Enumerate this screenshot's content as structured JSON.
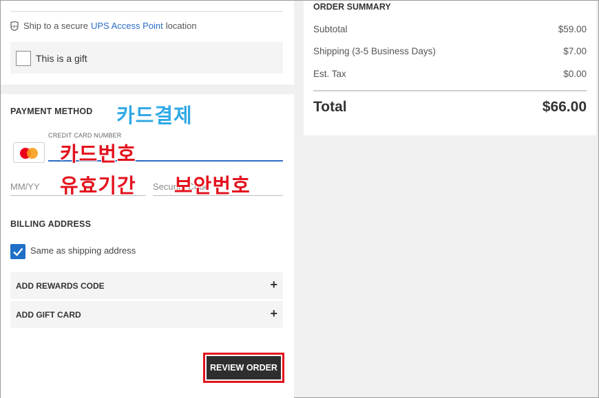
{
  "shipping": {
    "ship_prefix": "Ship to a secure",
    "ship_link": "UPS Access Point",
    "ship_suffix": "location",
    "gift_label": "This is a gift"
  },
  "payment": {
    "title": "PAYMENT METHOD",
    "annotation_title": "카드결제",
    "cc_label": "CREDIT CARD NUMBER",
    "annotation_cc": "카드번호",
    "expiry_placeholder": "MM/YY",
    "annotation_expiry": "유효기간",
    "security_placeholder": "Security Code",
    "annotation_security": "보안번호",
    "card_brand_icon": "mastercard-icon"
  },
  "billing": {
    "title": "BILLING ADDRESS",
    "same_as_shipping": "Same as shipping address",
    "same_as_shipping_checked": true
  },
  "accordions": [
    {
      "label": "ADD REWARDS CODE",
      "icon": "plus-icon"
    },
    {
      "label": "ADD GIFT CARD",
      "icon": "plus-icon"
    }
  ],
  "review_button": "REVIEW ORDER",
  "summary": {
    "title": "ORDER SUMMARY",
    "rows": [
      {
        "label": "Subtotal",
        "amount": "$59.00"
      },
      {
        "label": "Shipping (3-5 Business Days)",
        "amount": "$7.00"
      },
      {
        "label": "Est. Tax",
        "amount": "$0.00"
      }
    ],
    "total_label": "Total",
    "total_amount": "$66.00"
  },
  "colors": {
    "accent_blue": "#1f6fc7",
    "link_blue": "#2a6cc4",
    "annotation_red": "#e3121d",
    "annotation_blue": "#31a9e6",
    "button_dark": "#2e2e2e"
  }
}
